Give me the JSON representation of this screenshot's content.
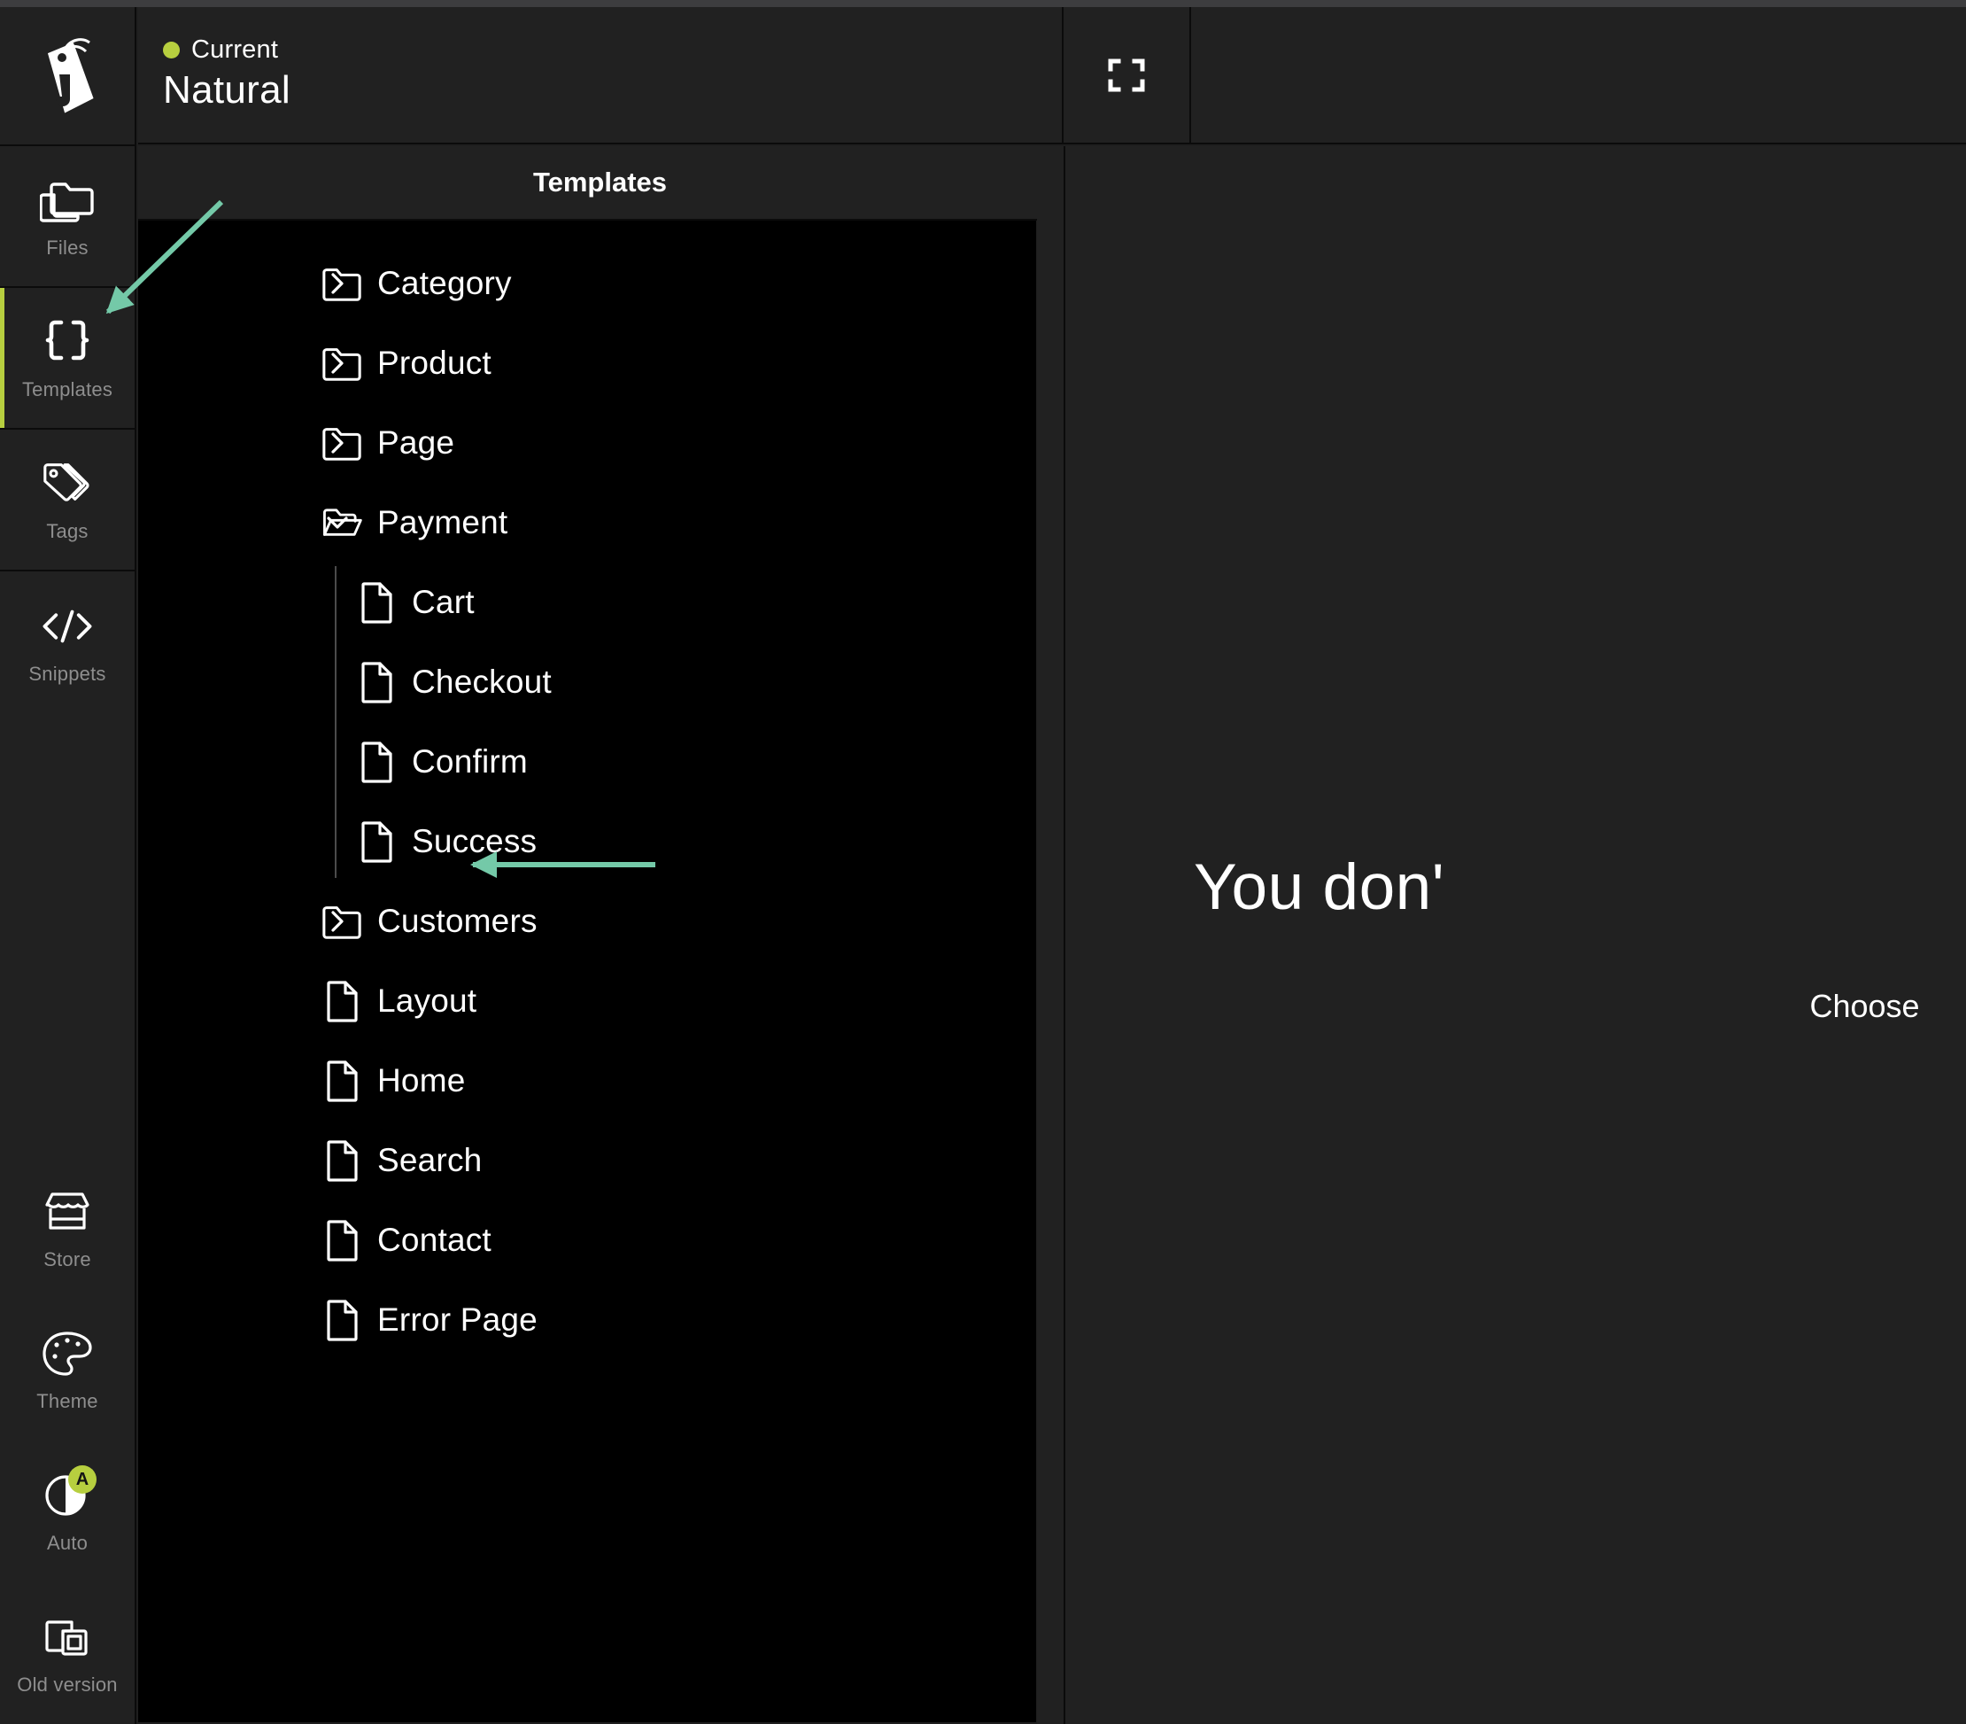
{
  "app": {
    "logo_icon": "tag-logo-icon"
  },
  "header": {
    "status_label": "Current",
    "theme_name": "Natural",
    "status_dot_color": "#b7cf3f",
    "expand_icon": "fullscreen-expand-icon"
  },
  "rail": {
    "items": [
      {
        "label": "Files",
        "icon": "folders-icon",
        "active": false
      },
      {
        "label": "Templates",
        "icon": "braces-icon",
        "active": true
      },
      {
        "label": "Tags",
        "icon": "tags-icon",
        "active": false
      },
      {
        "label": "Snippets",
        "icon": "code-icon",
        "active": false
      }
    ],
    "bottom_items": [
      {
        "label": "Store",
        "icon": "storefront-icon",
        "badge": ""
      },
      {
        "label": "Theme",
        "icon": "palette-icon",
        "badge": ""
      },
      {
        "label": "Auto",
        "icon": "auto-contrast-icon",
        "badge": "A"
      },
      {
        "label": "Old version",
        "icon": "windows-stack-icon",
        "badge": ""
      }
    ]
  },
  "templates_panel": {
    "title": "Templates",
    "tree": [
      {
        "label": "Category",
        "type": "folder",
        "expanded": false,
        "level": 0
      },
      {
        "label": "Product",
        "type": "folder",
        "expanded": false,
        "level": 0
      },
      {
        "label": "Page",
        "type": "folder",
        "expanded": false,
        "level": 0
      },
      {
        "label": "Payment",
        "type": "folder",
        "expanded": true,
        "level": 0
      },
      {
        "label": "Cart",
        "type": "file",
        "level": 1
      },
      {
        "label": "Checkout",
        "type": "file",
        "level": 1
      },
      {
        "label": "Confirm",
        "type": "file",
        "level": 1
      },
      {
        "label": "Success",
        "type": "file",
        "level": 1
      },
      {
        "label": "Customers",
        "type": "folder",
        "expanded": false,
        "level": 0
      },
      {
        "label": "Layout",
        "type": "file",
        "level": 0
      },
      {
        "label": "Home",
        "type": "file",
        "level": 0
      },
      {
        "label": "Search",
        "type": "file",
        "level": 0
      },
      {
        "label": "Contact",
        "type": "file",
        "level": 0
      },
      {
        "label": "Error Page",
        "type": "file",
        "level": 0
      }
    ]
  },
  "editor_pane": {
    "empty_title": "You don'",
    "empty_subtitle": "Choose"
  },
  "annotations": {
    "color": "#74c9a8",
    "arrow_to_templates_icon": "arrow-pointing-to-templates-rail-icon",
    "arrow_to_success": "arrow-pointing-to-success-template"
  },
  "colors": {
    "accent_green": "#b7cf3f",
    "annotation_teal": "#74c9a8",
    "panel_bg": "#212121",
    "tree_bg": "#000000",
    "divider": "#0b0b0b"
  }
}
